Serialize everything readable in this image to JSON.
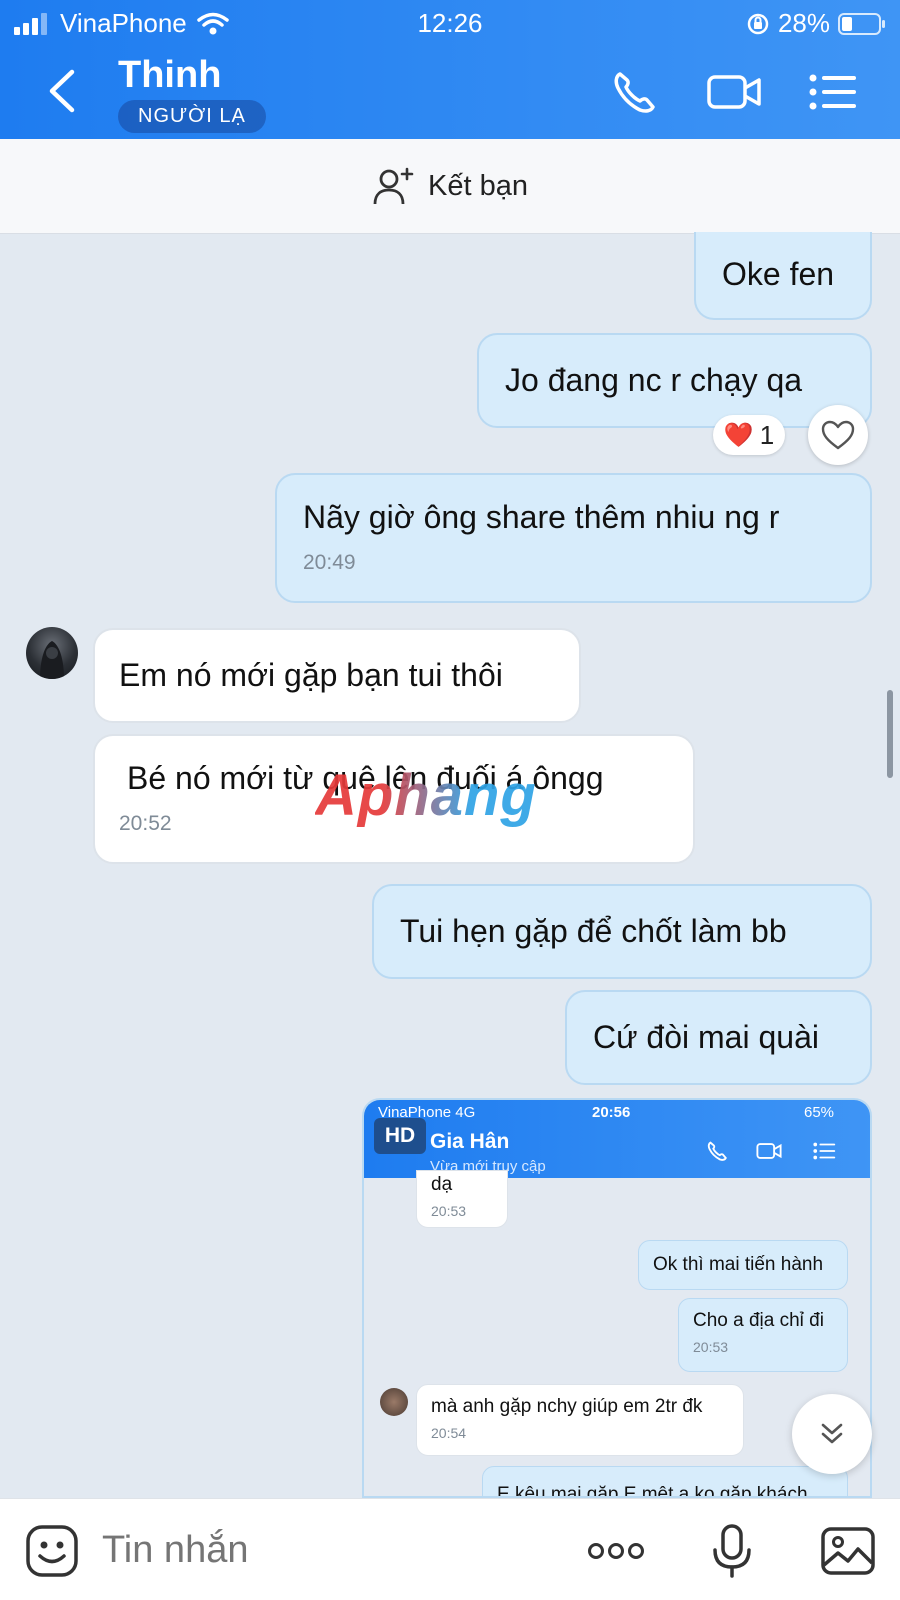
{
  "status_bar": {
    "carrier": "VinaPhone",
    "time": "12:26",
    "battery": "28%"
  },
  "header": {
    "contact_name": "Thinh",
    "badge": "NGƯỜI LẠ"
  },
  "add_friend": {
    "label": "Kết bạn"
  },
  "messages": [
    {
      "text": "Oke fen"
    },
    {
      "text": "Jo đang nc r chạy qa"
    },
    {
      "text": "Nãy giờ ông share thêm nhiu ng r",
      "time": "20:49"
    },
    {
      "text": "Em nó mới gặp bạn tui thôi"
    },
    {
      "text": "Bé nó mới từ quê lên đuối á ôngg",
      "time": "20:52"
    },
    {
      "text": "Tui hẹn gặp để chốt làm bb"
    },
    {
      "text": "Cứ đòi mai quài"
    }
  ],
  "reaction": {
    "emoji": "❤️",
    "count": "1"
  },
  "watermark": "Aphang",
  "embedded_screenshot": {
    "badge": "HD",
    "status_bar": {
      "carrier": "VinaPhone  4G",
      "time": "20:56",
      "battery": "65%"
    },
    "contact_name": "Gia Hân",
    "contact_status": "Vừa mới truy cập",
    "messages": [
      {
        "text": "dạ",
        "time": "20:53"
      },
      {
        "text": "Ok thì mai tiến hành"
      },
      {
        "text": "Cho a địa chỉ đi",
        "time": "20:53"
      },
      {
        "text": "mà anh gặp nchy giúp em 2tr đk",
        "time": "20:54"
      },
      {
        "text": "E kêu mai gặp E mệt a ko gặp khách"
      }
    ]
  },
  "input": {
    "placeholder": "Tin nhắn"
  },
  "icons": {
    "back": "chevron-left-icon",
    "call": "phone-icon",
    "video": "video-camera-icon",
    "menu": "list-menu-icon",
    "add_friend": "add-user-icon",
    "like": "heart-outline-icon",
    "scroll": "double-chevron-down-icon",
    "emoji": "emoji-icon",
    "more": "more-dots-icon",
    "mic": "microphone-icon",
    "image": "image-icon"
  },
  "colors": {
    "header": "#1e7cf0",
    "outgoing_bubble": "#d7ecfb",
    "incoming_bubble": "#ffffff",
    "chat_bg": "#e2e9f1"
  }
}
